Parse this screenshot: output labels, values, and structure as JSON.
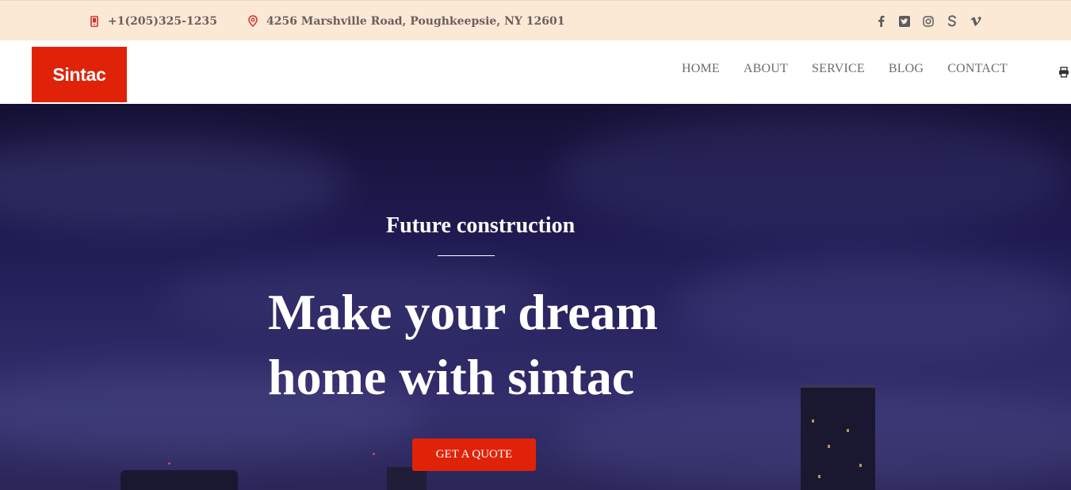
{
  "topbar": {
    "phone": "+1(205)325-1235",
    "address": "4256 Marshville Road, Poughkeepsie, NY 12601",
    "social": [
      "facebook-icon",
      "twitter-icon",
      "instagram-icon",
      "skype-icon",
      "vimeo-icon"
    ],
    "accent_color": "#d0302a"
  },
  "nav": {
    "logo": "Sintac",
    "items": [
      "HOME",
      "ABOUT",
      "SERVICE",
      "BLOG",
      "CONTACT"
    ],
    "brand_color": "#e02308"
  },
  "hero": {
    "subtitle": "Future construction",
    "headline_line1": "Make your dream",
    "headline_line2": "home with sintac",
    "button": "GET A QUOTE"
  }
}
